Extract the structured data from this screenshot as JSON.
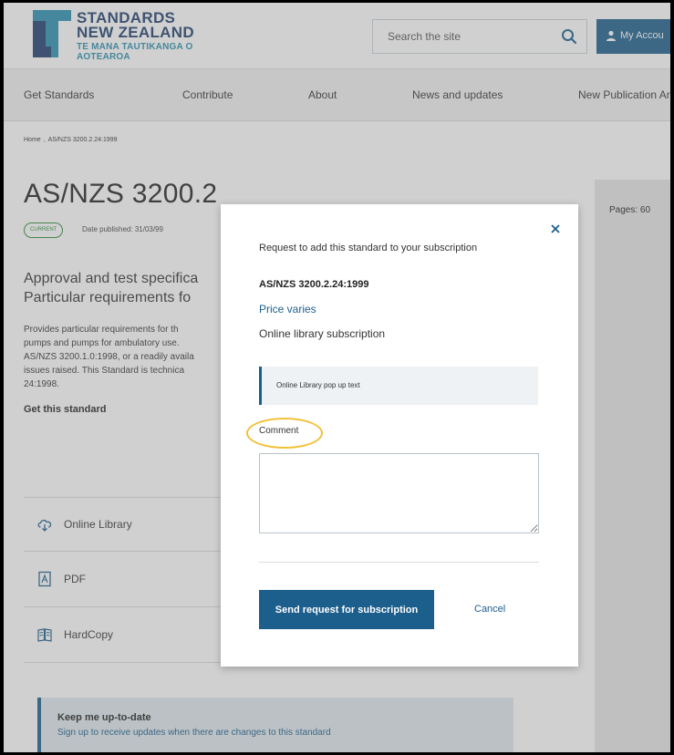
{
  "header": {
    "logo_line1": "STANDARDS",
    "logo_line2": "NEW ZEALAND",
    "logo_line3": "TE MANA TAUTIKANGA O AOTEAROA",
    "search_placeholder": "Search the site",
    "search_icon": "search-icon",
    "account_label": "My Accou"
  },
  "nav": {
    "items": [
      "Get Standards",
      "Contribute",
      "About",
      "News and updates",
      "New Publication An"
    ]
  },
  "breadcrumb": {
    "home": "Home",
    "separator": ",",
    "current": "AS/NZS 3200.2.24:1999"
  },
  "standard": {
    "title": "AS/NZS 3200.2",
    "status": "CURRENT",
    "date_published": "Date published: 31/03/99",
    "subtitle_line1": "Approval and test specifica",
    "subtitle_line2": "Particular requirements fo",
    "description_lines": [
      "Provides particular requirements for th",
      "pumps and pumps for ambulatory use.",
      "AS/NZS 3200.1.0:1998, or a readily availa",
      "issues raised. This Standard is technica",
      "24:1998."
    ],
    "pages": "Pages: 60"
  },
  "get_standard": {
    "title": "Get this standard",
    "options": [
      {
        "label": "Online Library",
        "icon": "cloud-icon"
      },
      {
        "label": "PDF",
        "icon": "pdf-icon"
      },
      {
        "label": "HardCopy",
        "icon": "book-icon"
      }
    ]
  },
  "keep_updated": {
    "title": "Keep me up-to-date",
    "text": "Sign up to receive updates when there are changes to this standard"
  },
  "modal": {
    "heading": "Request to add this standard to your subscription",
    "code": "AS/NZS 3200.2.24:1999",
    "price": "Price varies",
    "subscription": "Online library subscription",
    "info_text": "Online Library pop up text",
    "comment_label": "Comment",
    "comment_value": "",
    "send_label": "Send request for subscription",
    "cancel_label": "Cancel"
  },
  "colors": {
    "brand": "#1c5e8c",
    "current_badge": "#2f8c3a",
    "highlight_ring": "#f2c037"
  }
}
